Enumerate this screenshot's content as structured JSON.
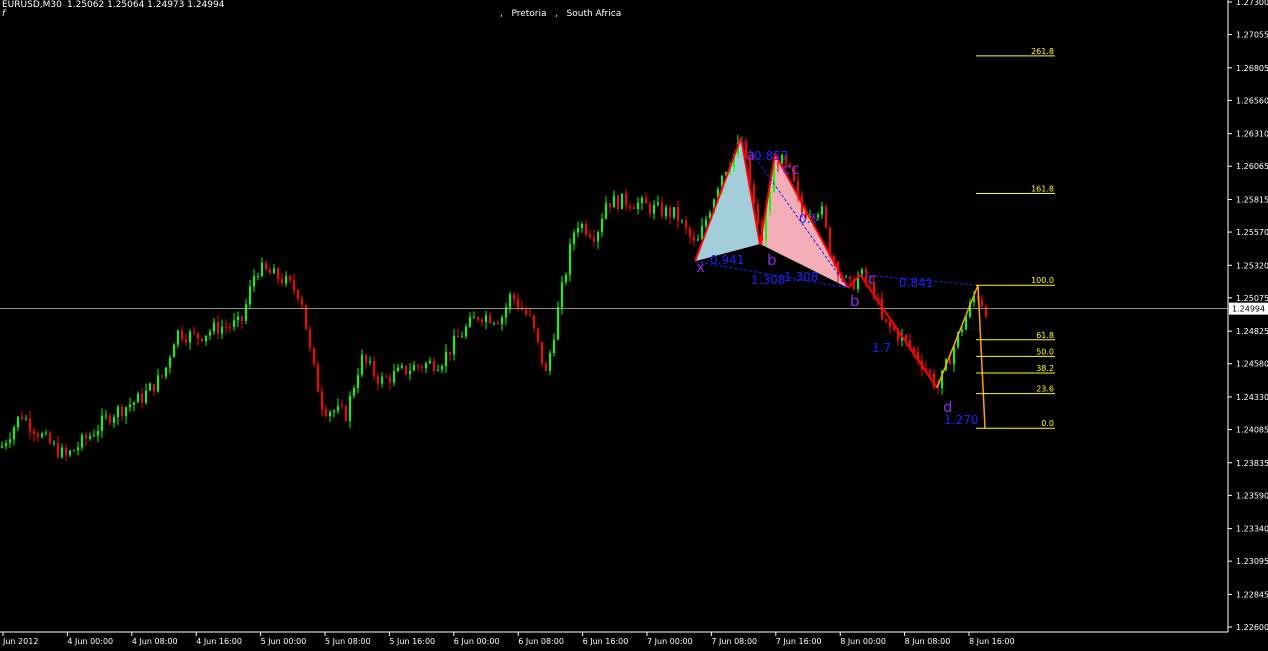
{
  "header": {
    "symbol": "EURUSD,M30",
    "ohlc": "1.25062 1.25064 1.24973 1.24994",
    "location": ",   Pretoria   ,   South Africa",
    "indicator_mark": "f"
  },
  "colors": {
    "background": "#000000",
    "axis": "#ffffff",
    "bull": "#00ff00",
    "bear": "#ff0000",
    "fib": "#ffff00",
    "bid_line": "#c0c0a0",
    "pattern_blue": "#2020ff",
    "pattern_purple": "#8a2be2",
    "harmonic_fill_1": "#add8e6",
    "harmonic_fill_2": "#ffb6c1",
    "leg_line": "#ffa500"
  },
  "chart_data": {
    "type": "candlestick",
    "symbol": "EURUSD",
    "timeframe": "M30",
    "ylim": [
      1.226,
      1.273
    ],
    "y_ticks": [
      "1.27300",
      "1.27055",
      "1.26805",
      "1.26560",
      "1.26310",
      "1.26065",
      "1.25815",
      "1.25570",
      "1.25320",
      "1.25075",
      "1.24825",
      "1.24580",
      "1.24330",
      "1.24085",
      "1.23835",
      "1.23590",
      "1.23340",
      "1.23095",
      "1.22845",
      "1.22600"
    ],
    "current_price": "1.24994",
    "x_ticks": [
      "Jun 2012",
      "4 Jun 00:00",
      "4 Jun 08:00",
      "4 Jun 16:00",
      "5 Jun 00:00",
      "5 Jun 08:00",
      "5 Jun 16:00",
      "6 Jun 00:00",
      "6 Jun 08:00",
      "6 Jun 16:00",
      "7 Jun 00:00",
      "7 Jun 08:00",
      "7 Jun 16:00",
      "8 Jun 00:00",
      "8 Jun 08:00",
      "8 Jun 16:00"
    ],
    "price_path": [
      [
        0,
        1.2395
      ],
      [
        20,
        1.242
      ],
      [
        45,
        1.24
      ],
      [
        65,
        1.2388
      ],
      [
        90,
        1.2405
      ],
      [
        110,
        1.242
      ],
      [
        140,
        1.2432
      ],
      [
        163,
        1.245
      ],
      [
        175,
        1.2482
      ],
      [
        195,
        1.2478
      ],
      [
        215,
        1.2485
      ],
      [
        240,
        1.2488
      ],
      [
        255,
        1.253
      ],
      [
        280,
        1.2522
      ],
      [
        300,
        1.251
      ],
      [
        310,
        1.2462
      ],
      [
        322,
        1.2425
      ],
      [
        345,
        1.242
      ],
      [
        360,
        1.2462
      ],
      [
        380,
        1.2445
      ],
      [
        410,
        1.2455
      ],
      [
        440,
        1.246
      ],
      [
        460,
        1.248
      ],
      [
        478,
        1.2495
      ],
      [
        500,
        1.2492
      ],
      [
        510,
        1.251
      ],
      [
        530,
        1.249
      ],
      [
        545,
        1.245
      ],
      [
        560,
        1.251
      ],
      [
        575,
        1.2565
      ],
      [
        595,
        1.2555
      ],
      [
        605,
        1.258
      ],
      [
        630,
        1.258
      ],
      [
        650,
        1.2575
      ],
      [
        675,
        1.257
      ],
      [
        695,
        1.2545
      ],
      [
        720,
        1.26
      ],
      [
        741,
        1.2625
      ],
      [
        760,
        1.2548
      ],
      [
        775,
        1.2615
      ],
      [
        790,
        1.26
      ],
      [
        800,
        1.2572
      ],
      [
        820,
        1.2575
      ],
      [
        830,
        1.254
      ],
      [
        848,
        1.2515
      ],
      [
        860,
        1.2525
      ],
      [
        875,
        1.251
      ],
      [
        880,
        1.249
      ],
      [
        900,
        1.2478
      ],
      [
        920,
        1.246
      ],
      [
        937,
        1.244
      ],
      [
        955,
        1.2475
      ],
      [
        975,
        1.2512
      ],
      [
        985,
        1.2499
      ]
    ],
    "fibonacci": {
      "levels": [
        "261.8",
        "161.8",
        "100.0",
        "61.8",
        "50.0",
        "38.2",
        "23.6",
        "0.0"
      ],
      "values": [
        1.26895,
        1.2586,
        1.2517,
        1.2476,
        1.24635,
        1.2451,
        1.24355,
        1.24095
      ]
    },
    "harmonic_pattern_1": {
      "points": [
        {
          "label": "x",
          "price": 1.2535
        },
        {
          "label": "a",
          "price": 1.2628
        },
        {
          "label": "b",
          "price": 1.2548
        },
        {
          "label": "c",
          "price": 1.2616
        },
        {
          "label": "d",
          "price": 1.2515
        }
      ],
      "ratios": [
        "0.941",
        "1.308",
        "1.308",
        "0.857",
        "0.5"
      ]
    },
    "harmonic_pattern_2": {
      "points": [
        {
          "label": "b",
          "price": 1.2515
        },
        {
          "label": "c",
          "price": 1.2525
        },
        {
          "label": "d",
          "price": 1.244
        }
      ],
      "ratios": [
        "0.841",
        "1.270",
        "1.7"
      ]
    }
  },
  "labels": {
    "ratio_x": "0.941",
    "ratio_b1": "1.308",
    "ratio_b2": "1.308",
    "ratio_a": "0.857",
    "ratio_c": "0.5",
    "ratio_cd": "0.841",
    "ratio_d": "1.270",
    "ratio_mid": "1.7",
    "pt_x": "x",
    "pt_a": "a",
    "pt_b": "b",
    "pt_c": "c",
    "pt_c2": "c",
    "pt_b2": "b",
    "pt_d": "d",
    "pt_c3": "c"
  }
}
